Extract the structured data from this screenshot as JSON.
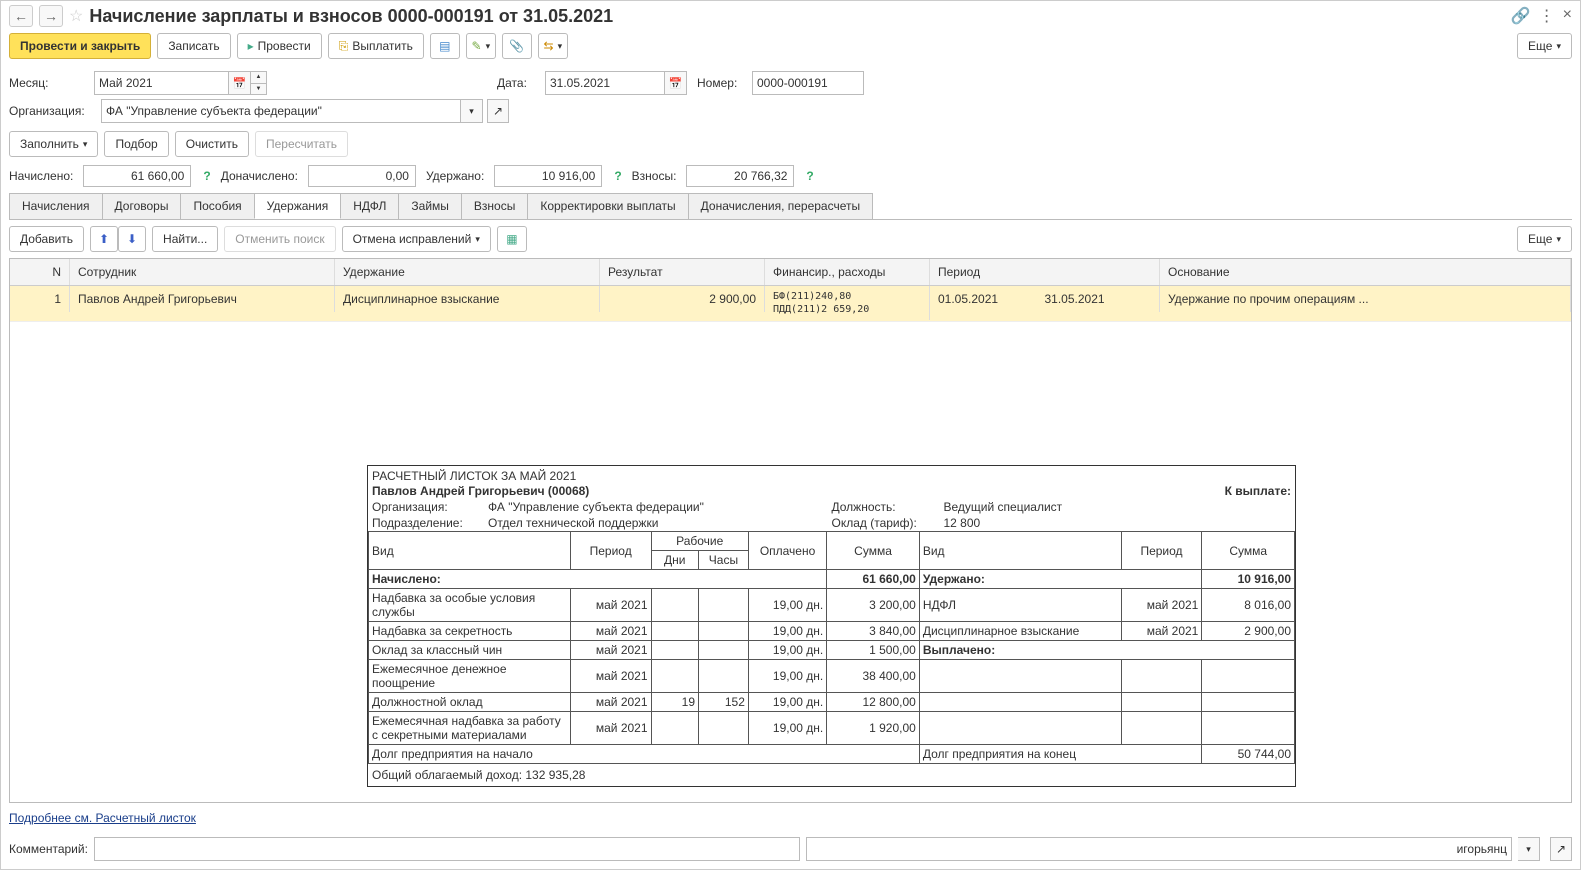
{
  "title": "Начисление зарплаты и взносов 0000-000191 от 31.05.2021",
  "toolbar": {
    "post_close": "Провести и закрыть",
    "write": "Записать",
    "post": "Провести",
    "payout": "Выплатить",
    "more": "Еще"
  },
  "fields": {
    "month_label": "Месяц:",
    "month_value": "Май 2021",
    "date_label": "Дата:",
    "date_value": "31.05.2021",
    "number_label": "Номер:",
    "number_value": "0000-000191",
    "org_label": "Организация:",
    "org_value": "ФА \"Управление субъекта федерации\""
  },
  "filter": {
    "fill": "Заполнить",
    "pick": "Подбор",
    "clear": "Очистить",
    "recalc": "Пересчитать"
  },
  "summary": {
    "accrued_label": "Начислено:",
    "accrued_value": "61 660,00",
    "additional_label": "Доначислено:",
    "additional_value": "0,00",
    "withheld_label": "Удержано:",
    "withheld_value": "10 916,00",
    "contributions_label": "Взносы:",
    "contributions_value": "20 766,32"
  },
  "tabs": [
    "Начисления",
    "Договоры",
    "Пособия",
    "Удержания",
    "НДФЛ",
    "Займы",
    "Взносы",
    "Корректировки выплаты",
    "Доначисления, перерасчеты"
  ],
  "subbar": {
    "add": "Добавить",
    "find": "Найти...",
    "cancel_search": "Отменить поиск",
    "cancel_corr": "Отмена исправлений",
    "more": "Еще"
  },
  "columns": {
    "n": "N",
    "employee": "Сотрудник",
    "deduction": "Удержание",
    "result": "Результат",
    "financing": "Финансир., расходы",
    "period": "Период",
    "basis": "Основание"
  },
  "row": {
    "n": "1",
    "employee": "Павлов Андрей Григорьевич",
    "deduction": "Дисциплинарное взыскание",
    "result": "2 900,00",
    "fin1": "БФ(211)240,80",
    "fin2": "ПДД(211)2 659,20",
    "period_from": "01.05.2021",
    "period_to": "31.05.2021",
    "basis": "Удержание по прочим операциям ..."
  },
  "link_text": "Подробнее см. Расчетный листок",
  "comment_label": "Комментарий:",
  "responsible_suffix": "игорьянц",
  "payslip": {
    "title": "РАСЧЕТНЫЙ ЛИСТОК ЗА МАЙ 2021",
    "name": "Павлов Андрей Григорьевич (00068)",
    "k_vyplate": "К выплате:",
    "org_label": "Организация:",
    "org_value": "ФА \"Управление субъекта федерации\"",
    "position_label": "Должность:",
    "position_value": "Ведущий специалист",
    "div_label": "Подразделение:",
    "div_value": "Отдел технической поддержки",
    "tariff_label": "Оклад (тариф):",
    "tariff_value": "12 800",
    "hdr_vid": "Вид",
    "hdr_period": "Период",
    "hdr_working": "Рабочие",
    "hdr_days": "Дни",
    "hdr_hours": "Часы",
    "hdr_paid": "Оплачено",
    "hdr_sum": "Сумма",
    "accrued": "Начислено:",
    "accrued_sum": "61 660,00",
    "withheld": "Удержано:",
    "withheld_sum": "10 916,00",
    "paid_out": "Выплачено:",
    "lines": [
      {
        "name": "Надбавка за особые условия службы",
        "period": "май 2021",
        "days": "",
        "hours": "",
        "paid": "19,00 дн.",
        "sum": "3 200,00"
      },
      {
        "name": "Надбавка за секретность",
        "period": "май 2021",
        "days": "",
        "hours": "",
        "paid": "19,00 дн.",
        "sum": "3 840,00"
      },
      {
        "name": "Оклад за классный чин",
        "period": "май 2021",
        "days": "",
        "hours": "",
        "paid": "19,00 дн.",
        "sum": "1 500,00"
      },
      {
        "name": "Ежемесячное денежное поощрение",
        "period": "май 2021",
        "days": "",
        "hours": "",
        "paid": "19,00 дн.",
        "sum": "38 400,00"
      },
      {
        "name": "Должностной оклад",
        "period": "май 2021",
        "days": "19",
        "hours": "152",
        "paid": "19,00 дн.",
        "sum": "12 800,00"
      },
      {
        "name": "Ежемесячная надбавка за работу с секретными материалами",
        "period": "май 2021",
        "days": "",
        "hours": "",
        "paid": "19,00 дн.",
        "sum": "1 920,00"
      }
    ],
    "wlines": [
      {
        "name": "НДФЛ",
        "period": "май 2021",
        "sum": "8 016,00"
      },
      {
        "name": "Дисциплинарное взыскание",
        "period": "май 2021",
        "sum": "2 900,00"
      }
    ],
    "debt_start": "Долг предприятия на начало",
    "debt_end": "Долг предприятия на конец",
    "debt_end_sum": "50 744,00",
    "taxable": "Общий облагаемый доход: 132 935,28"
  }
}
